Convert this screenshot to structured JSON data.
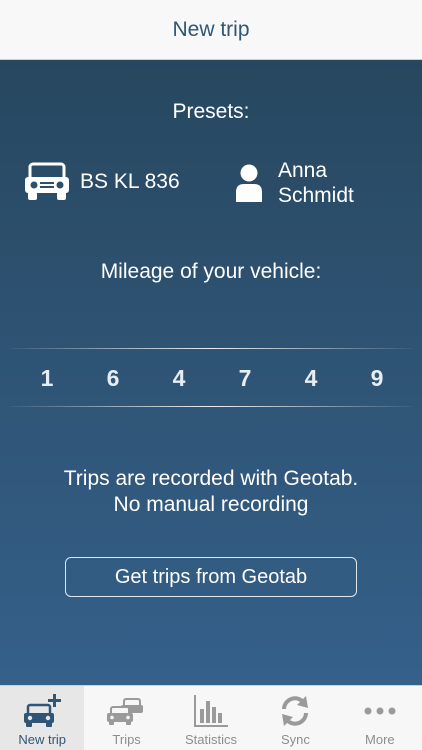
{
  "header": {
    "title": "New trip"
  },
  "presets": {
    "title": "Presets:",
    "vehicle_icon": "car-icon",
    "plate": "BS KL 836",
    "driver_icon": "person-icon",
    "driver_first": "Anna",
    "driver_last": "Schmidt"
  },
  "mileage": {
    "title": "Mileage of your vehicle:",
    "digits": [
      "1",
      "6",
      "4",
      "7",
      "4",
      "9"
    ]
  },
  "info": {
    "line1": "Trips are recorded with Geotab.",
    "line2": "No manual recording"
  },
  "geotab_button": {
    "label": "Get trips from Geotab"
  },
  "tabs": [
    {
      "label": "New trip",
      "icon": "add-car-icon",
      "active": true
    },
    {
      "label": "Trips",
      "icon": "cars-icon",
      "active": false
    },
    {
      "label": "Statistics",
      "icon": "bar-chart-icon",
      "active": false
    },
    {
      "label": "Sync",
      "icon": "sync-icon",
      "active": false
    },
    {
      "label": "More",
      "icon": "more-icon",
      "active": false
    }
  ],
  "colors": {
    "accent": "#2f5677",
    "background_top": "#27475f",
    "background_bottom": "#35608a",
    "tab_inactive": "#8d8d8d"
  }
}
